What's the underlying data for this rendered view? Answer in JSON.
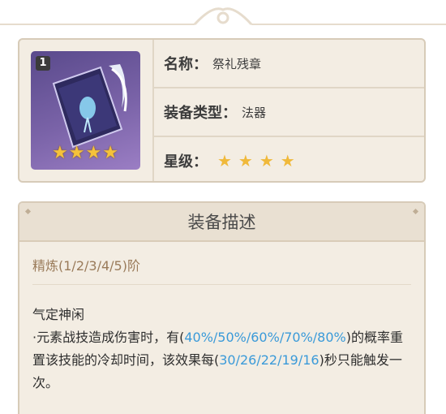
{
  "item": {
    "refine_level": "1",
    "name_label": "名称：",
    "name_value": "祭礼残章",
    "type_label": "装备类型：",
    "type_value": "法器",
    "rarity_label": "星级：",
    "rarity_stars": "★★★★",
    "thumb_stars": "★★★★"
  },
  "description": {
    "header": "装备描述",
    "refine_range": "精炼(1/2/3/4/5)阶",
    "effect_title": "气定神闲",
    "effect_part1": "·元素战技造成伤害时，有(",
    "effect_hl1": "40%/50%/60%/70%/80%",
    "effect_part2": ")的概率重置该技能的冷却时间，该效果每(",
    "effect_hl2": "30/26/22/19/16",
    "effect_part3": ")秒只能触发一次。"
  },
  "colors": {
    "highlight": "#3a9ad9",
    "star": "#f0b93a",
    "panel": "#f3ede3",
    "border": "#d7cbb8"
  }
}
